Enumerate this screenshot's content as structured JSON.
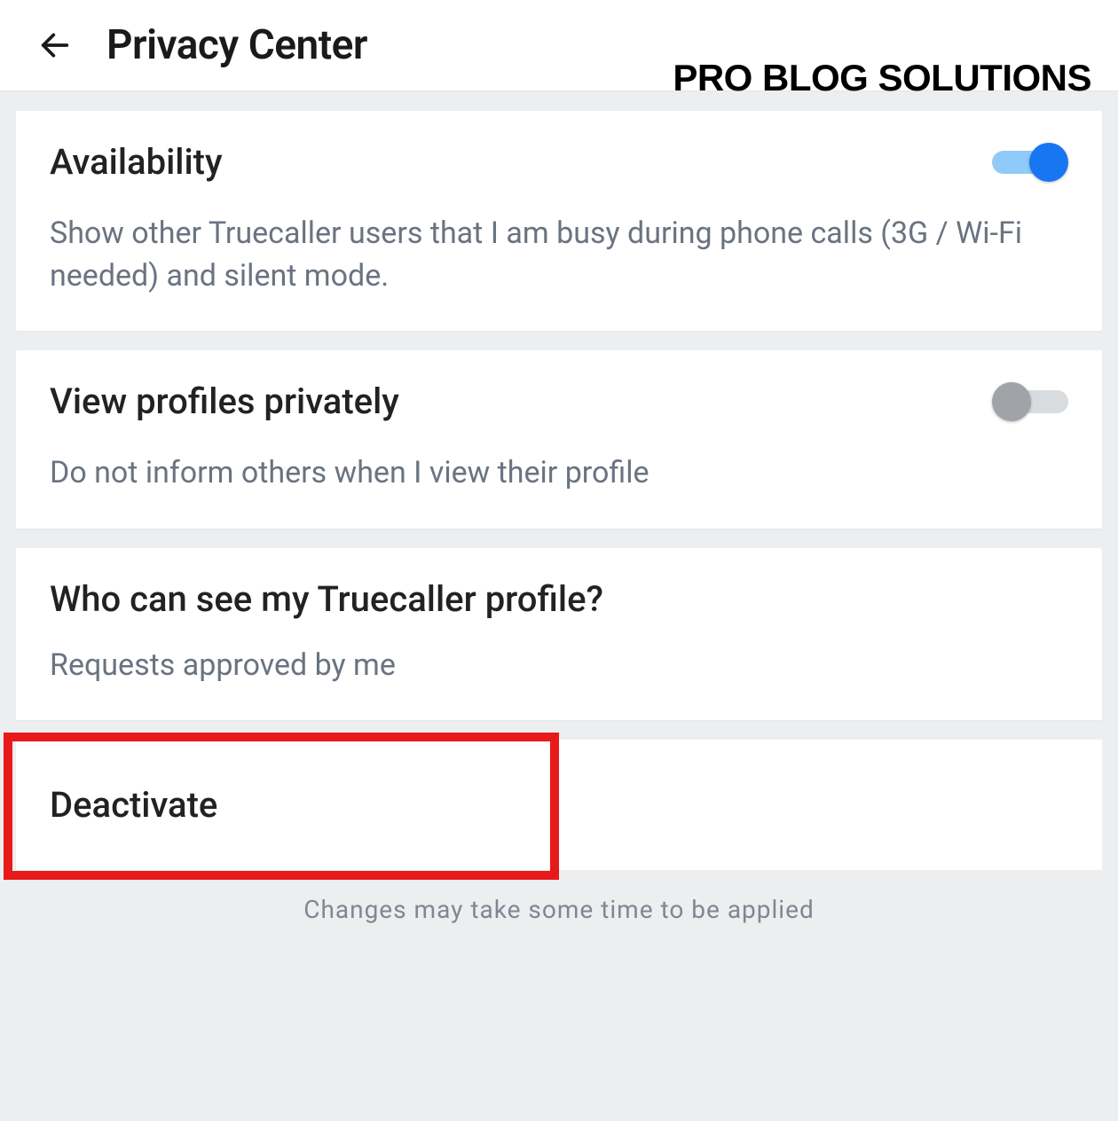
{
  "header": {
    "title": "Privacy Center",
    "watermark": "PRO BLOG SOLUTIONS"
  },
  "settings": {
    "availability": {
      "title": "Availability",
      "description": "Show other Truecaller users that I am busy during phone calls (3G / Wi-Fi needed) and silent mode.",
      "enabled": true
    },
    "view_privately": {
      "title": "View profiles privately",
      "description": "Do not inform others when I view their profile",
      "enabled": false
    },
    "profile_visibility": {
      "title": "Who can see my Truecaller profile?",
      "value": "Requests approved by me"
    },
    "deactivate": {
      "title": "Deactivate"
    }
  },
  "footer_note": "Changes may take some time to be applied"
}
